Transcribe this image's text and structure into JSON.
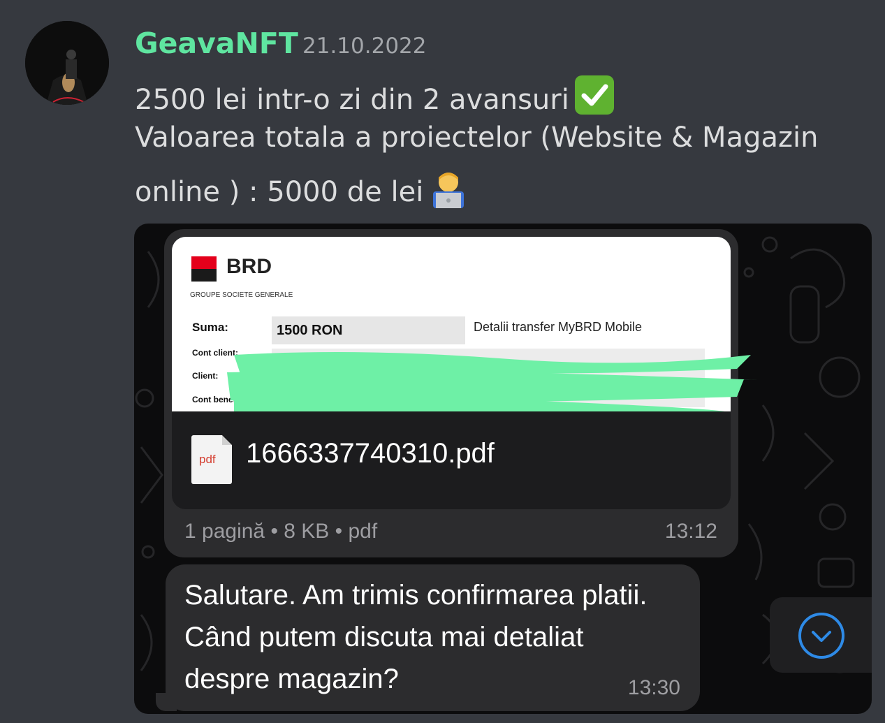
{
  "message": {
    "username": "GeavaNFT",
    "timestamp": "21.10.2022",
    "line1": "2500 lei intr-o zi din 2 avansuri",
    "line2": "Valoarea totala a proiectelor (Website & Magazin",
    "line3": "online ) : 5000 de lei"
  },
  "emoji": [
    "white-check-mark",
    "technologist"
  ],
  "attachment": {
    "document": {
      "bank_name": "BRD",
      "bank_subtitle": "GROUPE SOCIETE GENERALE",
      "label_sum": "Suma:",
      "amount": "1500 RON",
      "title": "Detalii transfer MyBRD Mobile",
      "label_account": "Cont client:",
      "label_client": "Client:",
      "label_beneficiary": "Cont benefic..."
    },
    "file_name": "1666337740310.pdf",
    "file_type_label": "pdf",
    "file_meta": "1 pagină • 8 KB • pdf",
    "file_time": "13:12"
  },
  "reply": {
    "text": "Salutare. Am trimis confirmarea platii. Când putem discuta mai detaliat despre magazin?",
    "time": "13:30"
  },
  "colors": {
    "username": "#5fe5a0",
    "background": "#36393f",
    "redaction": "#6ef0a6",
    "scroll_accent": "#2e8ae6"
  }
}
